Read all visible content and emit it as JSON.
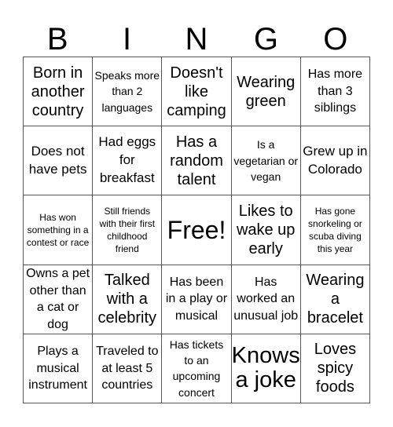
{
  "header": {
    "letters": [
      "B",
      "I",
      "N",
      "G",
      "O"
    ]
  },
  "cells": [
    [
      "Born in another country",
      "Speaks more than 2 languages",
      "Doesn't like camping",
      "Wearing green",
      "Has more than 3 siblings"
    ],
    [
      "Does not have pets",
      "Had eggs for breakfast",
      "Has a random talent",
      "Is a vegetarian or vegan",
      "Grew up in Colorado"
    ],
    [
      "Has won something in a contest or race",
      "Still friends with their first childhood friend",
      "Free!",
      "Likes to wake up early",
      "Has gone snorkeling or scuba diving this year"
    ],
    [
      "Owns a pet other than a cat or dog",
      "Talked with a celebrity",
      "Has been in a play or musical",
      "Has worked an unusual job",
      "Wearing a bracelet"
    ],
    [
      "Plays a musical instrument",
      "Traveled to at least 5 countries",
      "Has tickets to an upcoming concert",
      "Knows a joke",
      "Loves spicy foods"
    ]
  ]
}
